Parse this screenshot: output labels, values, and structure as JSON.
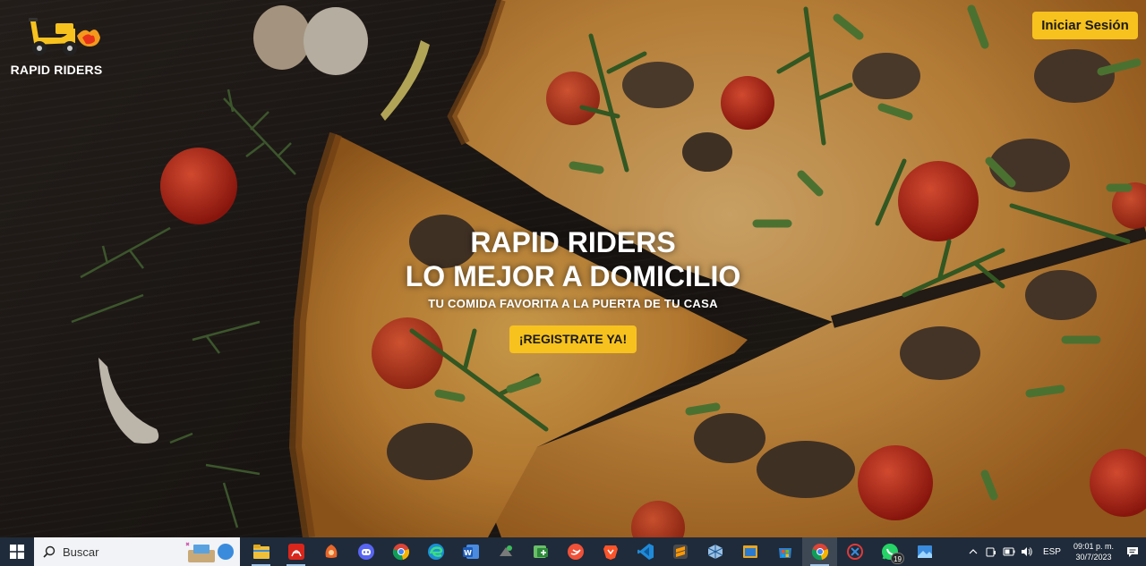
{
  "header": {
    "logo_text": "RAPID RIDERS",
    "login_label": "Iniciar Sesión"
  },
  "hero": {
    "title_line1": "RAPID RIDERS",
    "title_line2": "LO MEJOR A DOMICILIO",
    "subtitle": "TU COMIDA FAVORITA A LA PUERTA DE TU CASA",
    "cta_label": "¡REGISTRATE YA!"
  },
  "colors": {
    "accent": "#f7c21e",
    "taskbar": "#1f2b3a"
  },
  "taskbar": {
    "search_placeholder": "Buscar",
    "apps": [
      {
        "name": "file-explorer-icon",
        "running": true
      },
      {
        "name": "acrobat-reader-icon",
        "running": true
      },
      {
        "name": "phoenix-browser-icon",
        "running": false
      },
      {
        "name": "discord-icon",
        "running": false
      },
      {
        "name": "chrome-icon",
        "running": false
      },
      {
        "name": "edge-icon",
        "running": false
      },
      {
        "name": "word-icon",
        "running": false
      },
      {
        "name": "snipping-tool-icon",
        "running": false
      },
      {
        "name": "excel-add-icon",
        "running": false
      },
      {
        "name": "swift-icon",
        "running": false
      },
      {
        "name": "brave-icon",
        "running": false
      },
      {
        "name": "vscode-icon",
        "running": false
      },
      {
        "name": "sublime-icon",
        "running": false
      },
      {
        "name": "virtualbox-icon",
        "running": false
      },
      {
        "name": "window-tool-icon",
        "running": false
      },
      {
        "name": "store-icon",
        "running": false
      },
      {
        "name": "chrome-active-icon",
        "running": true
      },
      {
        "name": "snipping-app-icon",
        "running": false
      },
      {
        "name": "whatsapp-icon",
        "running": false
      },
      {
        "name": "photos-icon",
        "running": false
      }
    ],
    "whatsapp_badge": "19",
    "language": "ESP",
    "time": "09:01 p. m.",
    "date": "30/7/2023"
  }
}
